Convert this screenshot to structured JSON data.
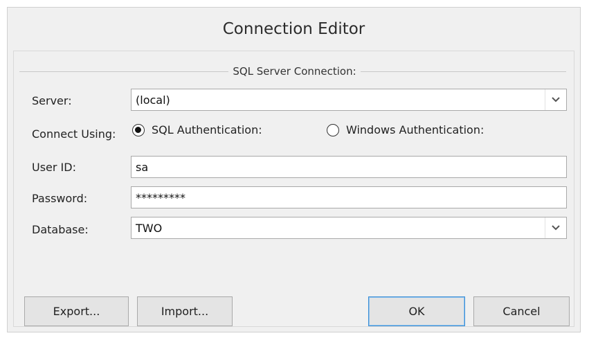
{
  "window": {
    "title": "Connection Editor"
  },
  "group": {
    "caption": "SQL Server Connection:"
  },
  "server": {
    "label": "Server:",
    "value": "(local)",
    "dropdown_icon": "chevron-down-icon"
  },
  "connect_using": {
    "label": "Connect Using:",
    "options": [
      {
        "label": "SQL Authentication:",
        "checked": true
      },
      {
        "label": "Windows Authentication:",
        "checked": false
      }
    ]
  },
  "user_id": {
    "label": "User ID:",
    "value": "sa"
  },
  "password": {
    "label": "Password:",
    "value": "*********"
  },
  "database": {
    "label": "Database:",
    "value": "TWO",
    "dropdown_icon": "chevron-down-icon"
  },
  "buttons": {
    "export": "Export...",
    "import": "Import...",
    "ok": "OK",
    "cancel": "Cancel"
  },
  "colors": {
    "window_bg": "#f0f0f0",
    "field_bg": "#ffffff",
    "default_button_border": "#3c8fd6"
  }
}
